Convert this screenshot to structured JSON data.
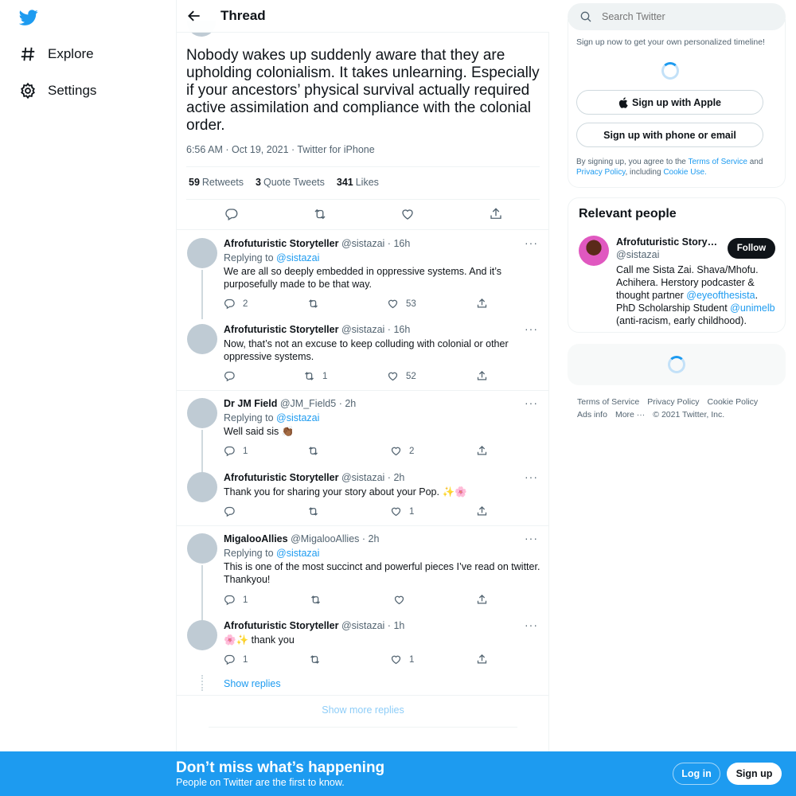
{
  "nav": {
    "items": [
      {
        "label": "Explore",
        "icon": "hashtag-icon"
      },
      {
        "label": "Settings",
        "icon": "gear-icon"
      }
    ]
  },
  "header": {
    "title": "Thread"
  },
  "tweet": {
    "text": "Nobody wakes up suddenly aware that they are upholding colonialism. It takes unlearning. Especially if your ancestors’ physical survival actually required active assimilation and compliance with the colonial order.",
    "meta": "6:56 AM · Oct 19, 2021 · Twitter for iPhone",
    "retweets": "59",
    "retweets_label": "Retweets",
    "quotes": "3",
    "quotes_label": "Quote Tweets",
    "likes": "341",
    "likes_label": "Likes"
  },
  "replies": [
    {
      "name": "Afrofuturistic Storyteller",
      "handle": "@sistazai",
      "time": "16h",
      "replying_prefix": "Replying to ",
      "replying_to": "@sistazai",
      "text": "We are all so deeply embedded in oppressive systems. And it’s purposefully made to be that way.",
      "replies": "2",
      "retweets": "",
      "likes": "53"
    },
    {
      "name": "Afrofuturistic Storyteller",
      "handle": "@sistazai",
      "time": "16h",
      "replying_prefix": "",
      "replying_to": "",
      "text": "Now, that’s not an excuse to keep colluding with colonial or other oppressive systems.",
      "replies": "",
      "retweets": "1",
      "likes": "52"
    },
    {
      "name": "Dr JM Field",
      "handle": "@JM_Field5",
      "time": "2h",
      "replying_prefix": "Replying to ",
      "replying_to": "@sistazai",
      "text": "Well said sis 👏🏾",
      "replies": "1",
      "retweets": "",
      "likes": "2"
    },
    {
      "name": "Afrofuturistic Storyteller",
      "handle": "@sistazai",
      "time": "2h",
      "replying_prefix": "",
      "replying_to": "",
      "text": "Thank you for sharing your story about your Pop. ✨🌸",
      "replies": "",
      "retweets": "",
      "likes": "1"
    },
    {
      "name": "MigalooAllies",
      "handle": "@MigalooAllies",
      "time": "2h",
      "replying_prefix": "Replying to ",
      "replying_to": "@sistazai",
      "text": "This is one of the most succinct and powerful pieces I’ve read on twitter. Thankyou!",
      "replies": "1",
      "retweets": "",
      "likes": ""
    },
    {
      "name": "Afrofuturistic Storyteller",
      "handle": "@sistazai",
      "time": "1h",
      "replying_prefix": "",
      "replying_to": "",
      "text": "🌸✨ thank you",
      "replies": "1",
      "retweets": "",
      "likes": "1"
    }
  ],
  "show_replies": "Show replies",
  "show_more_replies": "Show more replies",
  "search": {
    "placeholder": "Search Twitter"
  },
  "signup": {
    "subtitle": "Sign up now to get your own personalized timeline!",
    "apple_label": "Sign up with Apple",
    "phone_label": "Sign up with phone or email",
    "terms_prefix": "By signing up, you agree to the ",
    "terms_link": "Terms of Service",
    "terms_and": " and ",
    "privacy_link": "Privacy Policy",
    "terms_including": ", including ",
    "cookie_link": "Cookie Use."
  },
  "relevant": {
    "title": "Relevant people",
    "name": "Afrofuturistic Storyteller",
    "handle": "@sistazai",
    "follow_label": "Follow",
    "bio_1": "Call me Sista Zai. Shava/Mhofu. Achihera. Herstory podcaster & thought partner ",
    "bio_link1": "@eyeofthesista",
    "bio_2": ". PhD Scholarship Student ",
    "bio_link2": "@unimelb",
    "bio_3": " (anti-racism, early childhood)."
  },
  "footer": {
    "links": [
      "Terms of Service",
      "Privacy Policy",
      "Cookie Policy",
      "Ads info",
      "More ···",
      "© 2021 Twitter, Inc."
    ]
  },
  "bottombar": {
    "title": "Don’t miss what’s happening",
    "subtitle": "People on Twitter are the first to know.",
    "login": "Log in",
    "signup": "Sign up"
  },
  "colors": {
    "accent": "#1d9bf0",
    "text": "#0f1419",
    "muted": "#536471"
  }
}
